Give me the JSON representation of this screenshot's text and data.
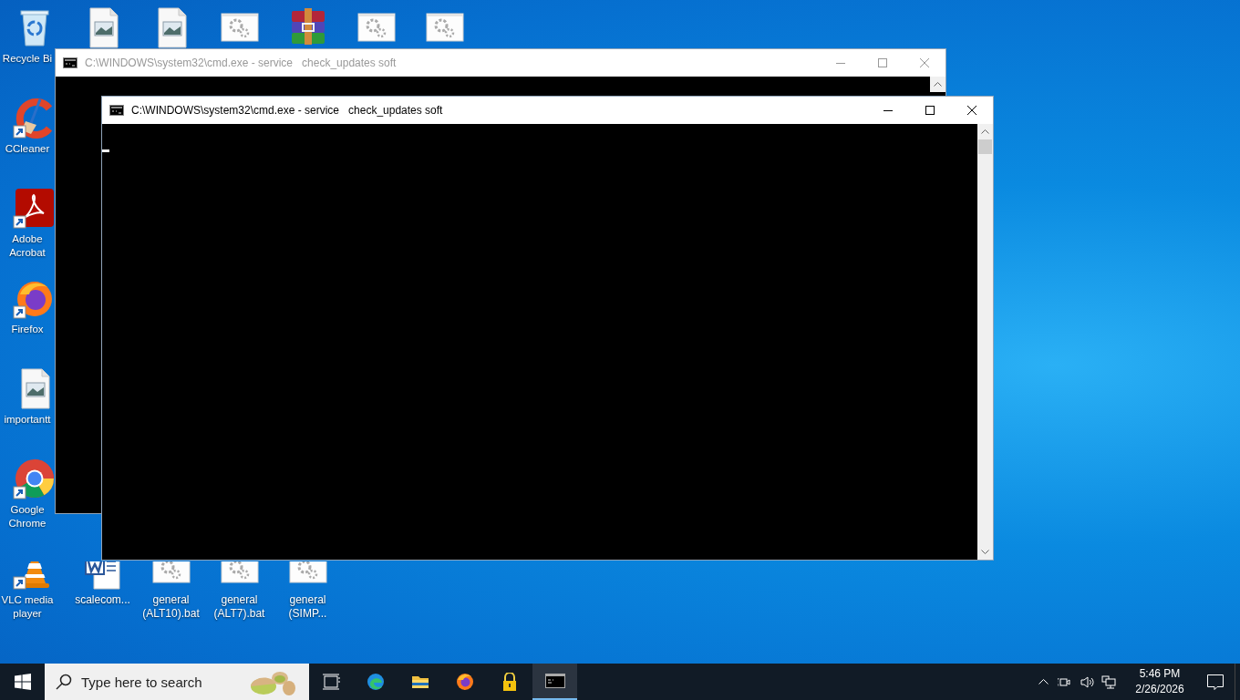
{
  "left_column": [
    {
      "label": "Recycle Bi",
      "kind": "recycle",
      "shortcut": false
    },
    {
      "label": "CCleaner",
      "kind": "ccleaner",
      "shortcut": true
    },
    {
      "label": "Adobe Acrobat",
      "kind": "acrobat",
      "shortcut": true
    },
    {
      "label": "Firefox",
      "kind": "firefox",
      "shortcut": true
    },
    {
      "label": "importantt",
      "kind": "image",
      "shortcut": false
    },
    {
      "label": "Google Chrome",
      "kind": "chrome",
      "shortcut": true
    },
    {
      "label": "VLC media player",
      "kind": "vlc",
      "shortcut": true
    }
  ],
  "top_row": [
    {
      "kind": "image"
    },
    {
      "kind": "image"
    },
    {
      "kind": "bat"
    },
    {
      "kind": "winrar"
    },
    {
      "kind": "bat"
    },
    {
      "kind": "bat"
    }
  ],
  "bottom_row": [
    {
      "label": "scalecom...",
      "kind": "word"
    },
    {
      "label": "general (ALT10).bat",
      "kind": "bat"
    },
    {
      "label": "general (ALT7).bat",
      "kind": "bat"
    },
    {
      "label": "general (SIMP...",
      "kind": "bat"
    }
  ],
  "windows": [
    {
      "title": "C:\\WINDOWS\\system32\\cmd.exe - service   check_updates soft",
      "active": false
    },
    {
      "title": "C:\\WINDOWS\\system32\\cmd.exe - service   check_updates soft",
      "active": true
    }
  ],
  "taskbar": {
    "search": {
      "placeholder": "Type here to search"
    },
    "apps": [
      {
        "kind": "taskview",
        "selected": false
      },
      {
        "kind": "edge",
        "selected": false
      },
      {
        "kind": "explorer",
        "selected": false
      },
      {
        "kind": "firefox",
        "selected": false
      },
      {
        "kind": "lock",
        "selected": false
      },
      {
        "kind": "cmd",
        "selected": true
      }
    ],
    "clock": {
      "time": "5:46 PM",
      "date": "2/26/2026"
    }
  }
}
